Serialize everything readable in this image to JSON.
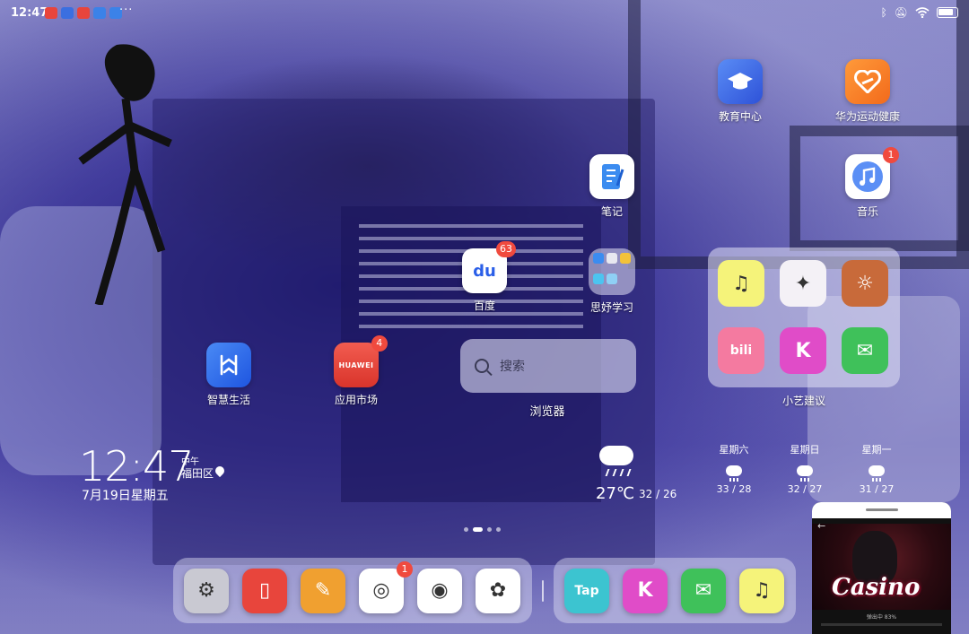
{
  "status_bar": {
    "time": "12:47",
    "more": "···",
    "notification_colors": [
      "#e8453c",
      "#3b6fe0",
      "#e8453c",
      "#3b82e8",
      "#3b82e8"
    ]
  },
  "apps": {
    "education": {
      "label": "教育中心",
      "color": "#3a6cf0"
    },
    "huawei_health": {
      "label": "华为运动健康",
      "color": "#f57a1e"
    },
    "notes": {
      "label": "笔记",
      "color": "#ffffff"
    },
    "music": {
      "label": "音乐",
      "color": "#ffffff",
      "badge": "1"
    },
    "baidu": {
      "label": "百度",
      "color": "#ffffff",
      "badge": "63",
      "glyph": "du"
    },
    "study_folder": {
      "label": "思妤学习"
    },
    "smart_life": {
      "label": "智慧生活",
      "color": "#2f6df2"
    },
    "app_market": {
      "label": "应用市场",
      "color": "#e8453c",
      "badge": "4",
      "glyph": "HUAWEI"
    },
    "xiaoyi_folder": {
      "label": "小艺建议"
    }
  },
  "folder_apps": [
    {
      "name": "qq-music-app",
      "color": "#f5f37a",
      "glyph": "♫"
    },
    {
      "name": "genshin-app",
      "color": "#f4f1f6",
      "glyph": "✦"
    },
    {
      "name": "sky-game-app",
      "color": "#c86a3a",
      "glyph": "☼"
    },
    {
      "name": "bilibili-app",
      "color": "#f47aa0",
      "glyph": "bili"
    },
    {
      "name": "kuaiying-app",
      "color": "#e04cc8",
      "glyph": "K"
    },
    {
      "name": "wechat-app",
      "color": "#3fc15a",
      "glyph": "✉"
    }
  ],
  "search": {
    "placeholder": "搜索",
    "label": "浏览器"
  },
  "clock": {
    "time": "12:47",
    "ampm": "中午",
    "place": "福田区",
    "date": "7月19日星期五"
  },
  "weather": {
    "temp": "27℃",
    "range": "32 / 26",
    "forecast": [
      {
        "day": "星期六",
        "range": "33 / 28"
      },
      {
        "day": "星期日",
        "range": "32 / 27"
      },
      {
        "day": "星期一",
        "range": "31 / 27"
      }
    ]
  },
  "dock_left": [
    {
      "name": "settings-app",
      "color": "#c9c9d2",
      "glyph": "⚙"
    },
    {
      "name": "books-app",
      "color": "#e8453c",
      "glyph": "▯"
    },
    {
      "name": "themes-app",
      "color": "#f0a030",
      "glyph": "✎"
    },
    {
      "name": "browser-app",
      "color": "#ffffff",
      "glyph": "◎",
      "badge": "1"
    },
    {
      "name": "camera-app",
      "color": "#ffffff",
      "glyph": "◉"
    },
    {
      "name": "gallery-app",
      "color": "#ffffff",
      "glyph": "✿"
    }
  ],
  "dock_right": [
    {
      "name": "taptap-app",
      "color": "#3cc4d0",
      "glyph": "Tap"
    },
    {
      "name": "kuaiying-app",
      "color": "#e04cc8",
      "glyph": "K"
    },
    {
      "name": "wechat-app",
      "color": "#3fc15a",
      "glyph": "✉"
    },
    {
      "name": "qq-music-app",
      "color": "#f5f37a",
      "glyph": "♫"
    }
  ],
  "float_window": {
    "title": "Casino",
    "back": "←",
    "caption": "弹出中 83%"
  }
}
